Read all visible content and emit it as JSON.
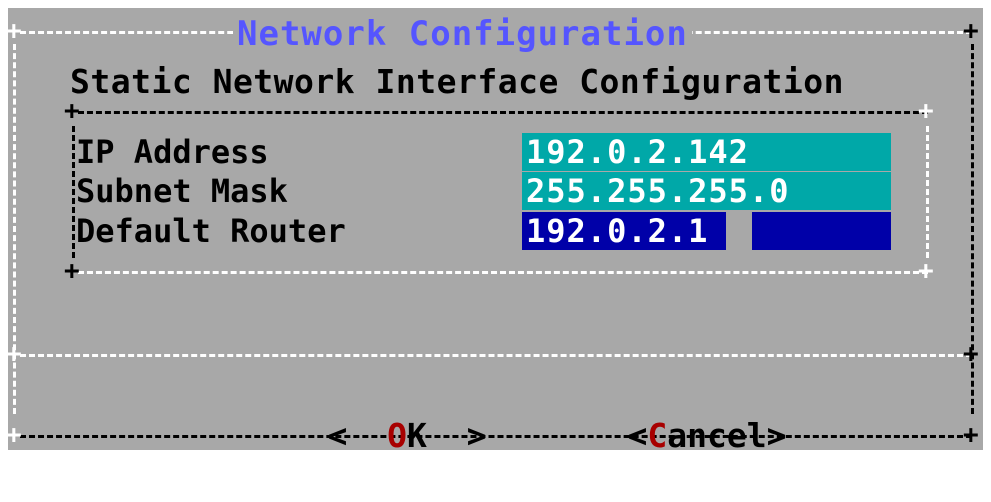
{
  "dialog": {
    "title": "Network Configuration",
    "subtitle": "Static Network Interface Configuration"
  },
  "form": {
    "fields": [
      {
        "label": "IP Address",
        "value": "192.0.2.142"
      },
      {
        "label": "Subnet Mask",
        "value": "255.255.255.0"
      },
      {
        "label": "Default Router",
        "value": "192.0.2.1"
      }
    ]
  },
  "buttons": {
    "ok": {
      "left_bracket": "<",
      "hotkey": "O",
      "rest": "K",
      "right_bracket": ">"
    },
    "cancel": {
      "left_bracket": "<",
      "hotkey": "C",
      "rest": "ancel",
      "right_bracket": ">"
    }
  },
  "colors": {
    "dialog_bg": "#a8a8a8",
    "title": "#5555ff",
    "field_bg": "#00a8a8",
    "focused_field_bg": "#0000a8",
    "hotkey": "#a80000"
  }
}
